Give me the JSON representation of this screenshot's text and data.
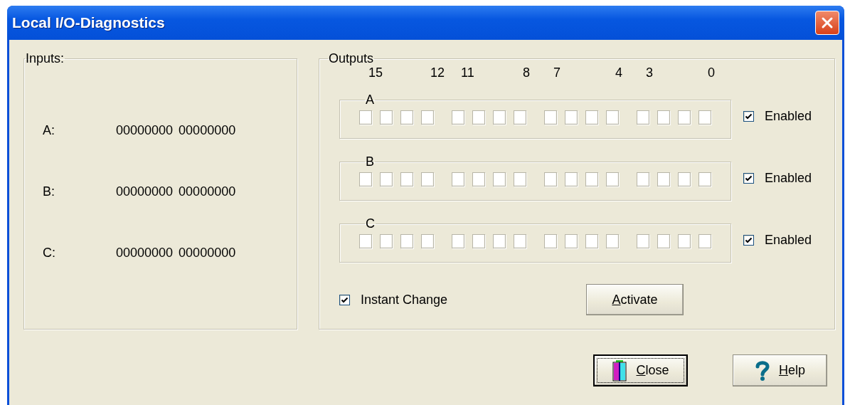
{
  "window": {
    "title": "Local I/O-Diagnostics"
  },
  "inputs": {
    "title": "Inputs:",
    "rows": [
      {
        "label": "A:",
        "high": "00000000",
        "low": "00000000"
      },
      {
        "label": "B:",
        "high": "00000000",
        "low": "00000000"
      },
      {
        "label": "C:",
        "high": "00000000",
        "low": "00000000"
      }
    ]
  },
  "outputs": {
    "title": "Outputs",
    "bit_labels": [
      "15",
      "12",
      "11",
      "8",
      "7",
      "4",
      "3",
      "0"
    ],
    "ports": [
      {
        "label": "A",
        "enabled_label": "Enabled",
        "enabled": true,
        "bits": [
          false,
          false,
          false,
          false,
          false,
          false,
          false,
          false,
          false,
          false,
          false,
          false,
          false,
          false,
          false,
          false
        ]
      },
      {
        "label": "B",
        "enabled_label": "Enabled",
        "enabled": true,
        "bits": [
          false,
          false,
          false,
          false,
          false,
          false,
          false,
          false,
          false,
          false,
          false,
          false,
          false,
          false,
          false,
          false
        ]
      },
      {
        "label": "C",
        "enabled_label": "Enabled",
        "enabled": true,
        "bits": [
          false,
          false,
          false,
          false,
          false,
          false,
          false,
          false,
          false,
          false,
          false,
          false,
          false,
          false,
          false,
          false
        ]
      }
    ],
    "instant_change": {
      "label": "Instant Change",
      "checked": true
    },
    "activate_button": {
      "mnemonic": "A",
      "label_rest": "ctivate"
    }
  },
  "buttons": [
    {
      "kind": "close",
      "mnemonic": "C",
      "label_rest": "lose",
      "focused": true
    },
    {
      "kind": "help",
      "mnemonic": "H",
      "label_rest": "elp",
      "focused": false
    }
  ]
}
